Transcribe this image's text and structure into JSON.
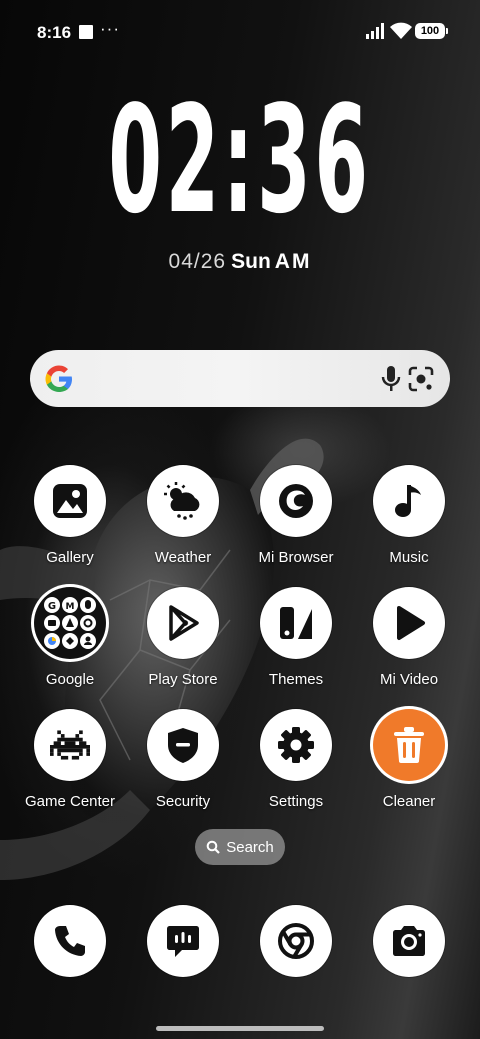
{
  "status_bar": {
    "time": "8:16",
    "dots": "···",
    "battery": "100"
  },
  "clock": {
    "time": "02:36",
    "date": "04/26",
    "weekday": "Sun",
    "ampm": "AM"
  },
  "search_widget": {
    "g": "G"
  },
  "apps": [
    {
      "label": "Gallery",
      "icon": "gallery-icon"
    },
    {
      "label": "Weather",
      "icon": "weather-icon"
    },
    {
      "label": "Mi Browser",
      "icon": "browser-icon"
    },
    {
      "label": "Music",
      "icon": "music-icon"
    },
    {
      "label": "Google",
      "icon": "google-folder-icon"
    },
    {
      "label": "Play Store",
      "icon": "play-store-icon"
    },
    {
      "label": "Themes",
      "icon": "themes-icon"
    },
    {
      "label": "Mi Video",
      "icon": "video-icon"
    },
    {
      "label": "Game Center",
      "icon": "game-icon"
    },
    {
      "label": "Security",
      "icon": "security-icon"
    },
    {
      "label": "Settings",
      "icon": "gear-icon"
    },
    {
      "label": "Cleaner",
      "icon": "trash-icon"
    }
  ],
  "app_search": {
    "label": "Search"
  },
  "dock": [
    {
      "icon": "phone-icon"
    },
    {
      "icon": "messaging-icon"
    },
    {
      "icon": "chrome-icon"
    },
    {
      "icon": "camera-icon"
    }
  ],
  "colors": {
    "cleaner": "#f07a2a",
    "google_blue": "#4285f4",
    "google_red": "#ea4335",
    "google_yellow": "#fbbc05",
    "google_green": "#34a853"
  }
}
